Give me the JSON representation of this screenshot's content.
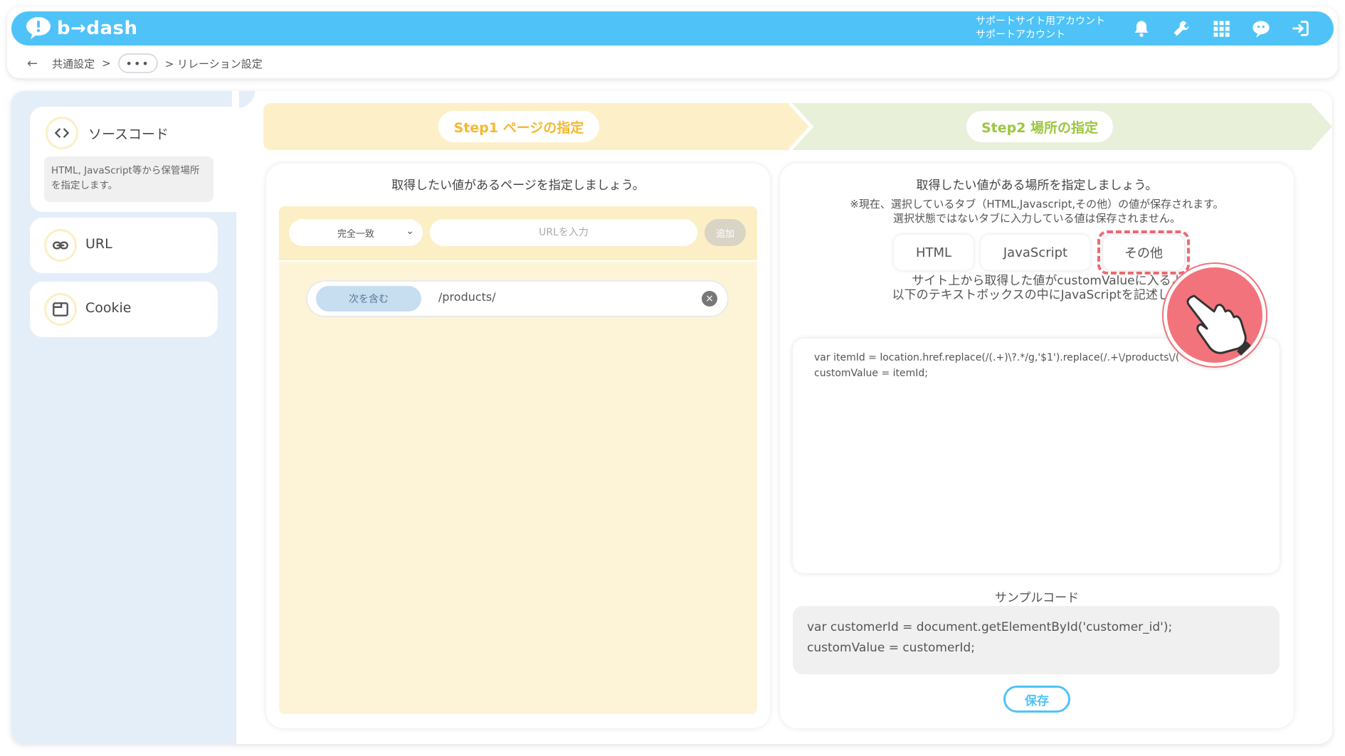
{
  "header": {
    "logo_text": "b→dash",
    "account_line1": "サポートサイト用アカウント",
    "account_line2": "サポートアカウント",
    "icons": [
      "bell-icon",
      "wrench-icon",
      "apps-grid-icon",
      "support-chat-icon",
      "logout-icon"
    ]
  },
  "breadcrumb": {
    "back": "←",
    "item1": "共通設定",
    "sep": ">",
    "more": "•••",
    "current": "> リレーション設定"
  },
  "sidebar": {
    "items": [
      {
        "label": "ソースコード",
        "icon": "code-brackets-icon",
        "description": "HTML, JavaScript等から保管場所を指定します。"
      },
      {
        "label": "URL",
        "icon": "link-icon"
      },
      {
        "label": "Cookie",
        "icon": "browser-window-icon"
      }
    ]
  },
  "steps": {
    "step1": "Step1 ページの指定",
    "step2": "Step2 場所の指定"
  },
  "left_panel": {
    "title": "取得したい値があるページを指定しましょう。",
    "match_select": "完全一致",
    "url_placeholder": "URLを入力",
    "add_button": "追加",
    "condition": {
      "type": "次を含む",
      "value": "/products/"
    }
  },
  "right_panel": {
    "title": "取得したい値がある場所を指定しましょう。",
    "notice_line1": "※現在、選択しているタブ（HTML,Javascript,その他）の値が保存されます。",
    "notice_line2": "選択状態ではないタブに入力している値は保存されません。",
    "tabs": [
      "HTML",
      "JavaScript",
      "その他"
    ],
    "selected_tab": "その他",
    "guide_line1": "サイト上から取得した値がcustomValueに入るよ",
    "guide_line2": "以下のテキストボックスの中にJavaScriptを記述して",
    "code": "var itemId = location.href.replace(/(.+)\\?.*/g,'$1').replace(/.+\\/products\\/(\ncustomValue = itemId;",
    "sample_title": "サンプルコード",
    "sample_line1": "var customerId = document.getElementById('customer_id');",
    "sample_line2": "customValue = customerId;",
    "save_button": "保存"
  },
  "colors": {
    "header": "#4fc3f7",
    "step1": "#fdf0c9",
    "step1_text": "#f5b82e",
    "step2": "#e8f0da",
    "step2_text": "#9cc63f",
    "highlight": "#ef6b73"
  }
}
